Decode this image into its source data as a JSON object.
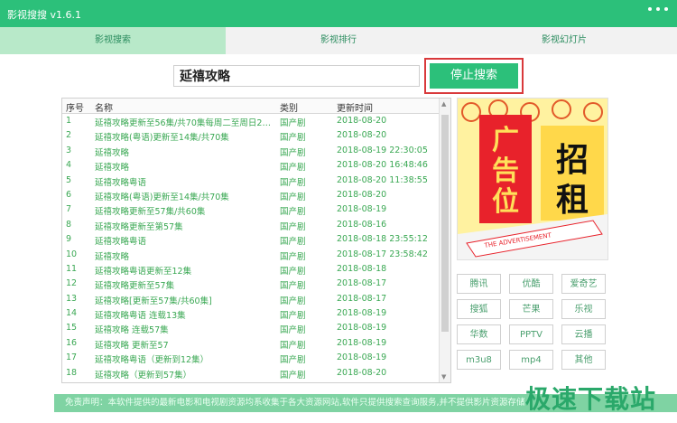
{
  "app": {
    "title": "影视搜搜 v1.6.1"
  },
  "tabs": [
    {
      "label": "影视搜索"
    },
    {
      "label": "影视排行"
    },
    {
      "label": "影视幻灯片"
    }
  ],
  "search": {
    "value": "延禧攻略",
    "button_label": "停止搜索"
  },
  "table": {
    "headers": [
      "序号",
      "名称",
      "类别",
      "更新时间"
    ],
    "rows": [
      [
        "1",
        "延禧攻略更新至56集/共70集每周二至周日20...",
        "国产剧",
        "2018-08-20"
      ],
      [
        "2",
        "延禧攻略(粤语)更新至14集/共70集",
        "国产剧",
        "2018-08-20"
      ],
      [
        "3",
        "延禧攻略",
        "国产剧",
        "2018-08-19 22:30:05"
      ],
      [
        "4",
        "延禧攻略",
        "国产剧",
        "2018-08-20 16:48:46"
      ],
      [
        "5",
        "延禧攻略粤语",
        "国产剧",
        "2018-08-20 11:38:55"
      ],
      [
        "6",
        "延禧攻略(粤语)更新至14集/共70集",
        "国产剧",
        "2018-08-20"
      ],
      [
        "7",
        "延禧攻略更新至57集/共60集",
        "国产剧",
        "2018-08-19"
      ],
      [
        "8",
        "延禧攻略更新至第57集",
        "国产剧",
        "2018-08-16"
      ],
      [
        "9",
        "延禧攻略粤语",
        "国产剧",
        "2018-08-18 23:55:12"
      ],
      [
        "10",
        "延禧攻略",
        "国产剧",
        "2018-08-17 23:58:42"
      ],
      [
        "11",
        "延禧攻略粤语更新至12集",
        "国产剧",
        "2018-08-18"
      ],
      [
        "12",
        "延禧攻略更新至57集",
        "国产剧",
        "2018-08-17"
      ],
      [
        "13",
        "延禧攻略[更新至57集/共60集]",
        "国产剧",
        "2018-08-17"
      ],
      [
        "14",
        "延禧攻略粤语 连载13集",
        "国产剧",
        "2018-08-19"
      ],
      [
        "15",
        "延禧攻略 连载57集",
        "国产剧",
        "2018-08-19"
      ],
      [
        "16",
        "延禧攻略 更新至57",
        "国产剧",
        "2018-08-19"
      ],
      [
        "17",
        "延禧攻略粤语（更新到12集）",
        "国产剧",
        "2018-08-19"
      ],
      [
        "18",
        "延禧攻略（更新到57集）",
        "国产剧",
        "2018-08-20"
      ]
    ]
  },
  "ad": {
    "text_left": "广告位",
    "text_right": "招租",
    "banner_line": "THE ADVERTISEMENT"
  },
  "sources": [
    "腾讯",
    "优酷",
    "爱奇艺",
    "搜狐",
    "芒果",
    "乐视",
    "华数",
    "PPTV",
    "云播",
    "m3u8",
    "mp4",
    "其他"
  ],
  "footer": {
    "text": "免责声明：本软件提供的最新电影和电视剧资源均系收集于各大资源网站,软件只提供搜索查询服务,并不提供影片资源存储"
  },
  "watermark": {
    "text": "极速下载站"
  },
  "colors": {
    "brand": "#2cc07a",
    "tab_active": "#b8e9c9",
    "row_text": "#3aa853",
    "highlight_border": "#d9393b"
  }
}
